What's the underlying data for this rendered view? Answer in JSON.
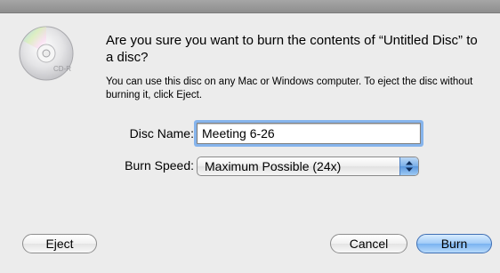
{
  "dialog": {
    "icon": "cd-r-disc-icon",
    "icon_label": "CD-R",
    "title": "Are you sure you want to burn the contents of “Untitled Disc” to a disc?",
    "info": "You can use this disc on any Mac or Windows computer. To eject the disc without burning it, click Eject.",
    "disc_name": {
      "label": "Disc Name:",
      "value": "Meeting 6-26"
    },
    "burn_speed": {
      "label": "Burn Speed:",
      "selected": "Maximum Possible (24x)"
    },
    "buttons": {
      "eject": "Eject",
      "cancel": "Cancel",
      "burn": "Burn"
    }
  },
  "colors": {
    "background": "#ececec",
    "focus_ring": "#86b4ec",
    "default_button": "#79b2f0"
  }
}
